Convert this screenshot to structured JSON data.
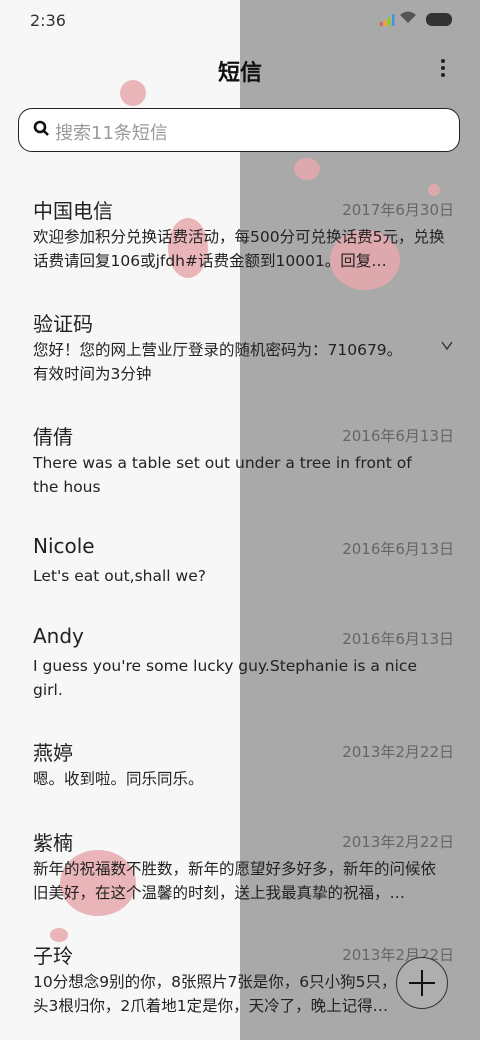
{
  "status_bar": {
    "time": "2:36"
  },
  "header": {
    "title": "短信"
  },
  "search": {
    "placeholder": "搜索11条短信"
  },
  "messages": [
    {
      "name": "中国电信",
      "date": "2017年6月30日",
      "preview": "欢迎参加积分兑换话费活动，每500分可兑换话费5元，兑换话费请回复106或jfdh#话费金额到10001。回复…"
    },
    {
      "name": "验证码",
      "date": "",
      "preview": "您好！您的网上营业厅登录的随机密码为：710679。有效时间为3分钟"
    },
    {
      "name": "倩倩",
      "date": "2016年6月13日",
      "preview": "There was a table set out under a tree in front of the hous"
    },
    {
      "name": "Nicole",
      "date": "2016年6月13日",
      "preview": "Let's eat out,shall we?"
    },
    {
      "name": "Andy",
      "date": "2016年6月13日",
      "preview": "I guess you're some lucky guy.Stephanie is a nice girl."
    },
    {
      "name": "燕婷",
      "date": "2013年2月22日",
      "preview": "嗯。收到啦。同乐同乐。"
    },
    {
      "name": "紫楠",
      "date": "2013年2月22日",
      "preview": "新年的祝福数不胜数，新年的愿望好多好多，新年的问候依旧美好，在这个温馨的时刻，送上我最真挚的祝福，…"
    },
    {
      "name": "子玲",
      "date": "2013年2月22日",
      "preview": "10分想念9别的你，8张照片7张是你，6只小狗5只，4根骨头3根归你，2爪着地1定是你，天冷了，晚上记得…"
    }
  ],
  "pin_icon": "collapse-icon",
  "fab": {
    "icon": "plus-icon"
  },
  "colors": {
    "left_bg": "#f7f7f7",
    "right_bg": "#a9a9a9",
    "splat": "#e8a9ad"
  }
}
